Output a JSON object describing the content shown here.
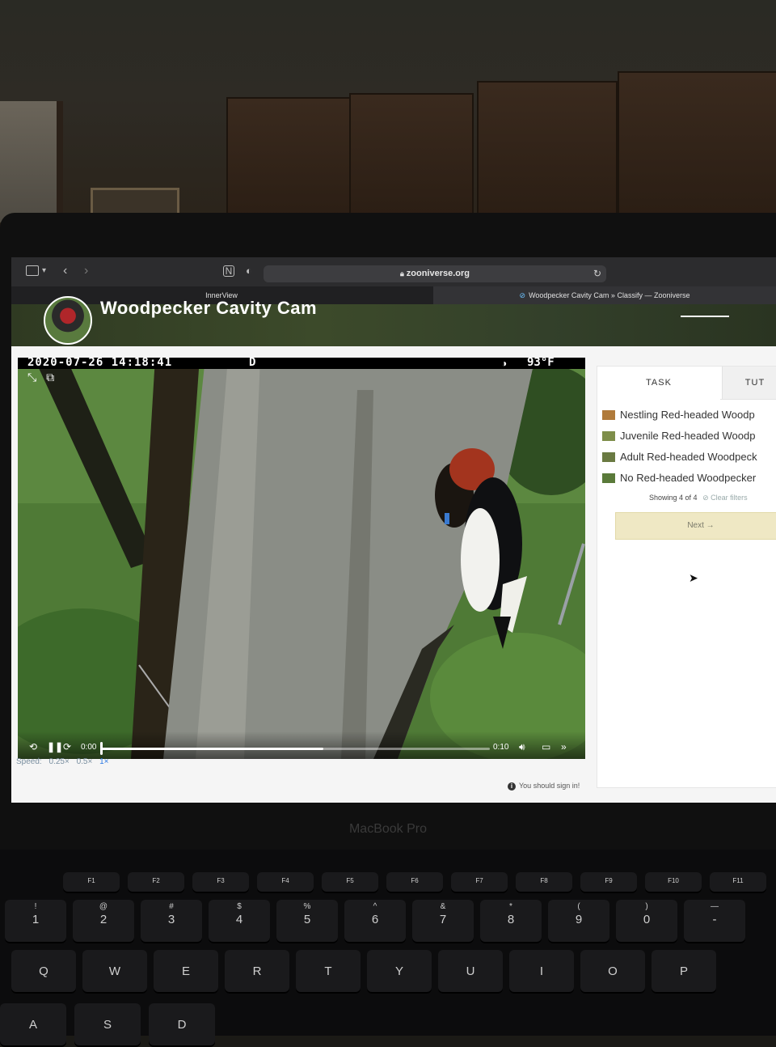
{
  "browser": {
    "url": "zooniverse.org",
    "tabs": [
      "InnerView",
      "Woodpecker Cavity Cam » Classify — Zooniverse"
    ]
  },
  "site": {
    "project_title": "Woodpecker Cavity Cam"
  },
  "video": {
    "timestamp": "2020-07-26 14:18:41",
    "mode": "D",
    "temperature": "93°F",
    "current_time": "0:00",
    "duration": "0:10",
    "progress": 0.57,
    "speed_label": "Speed:",
    "speeds": [
      "0.25×",
      "0.5×",
      "1×"
    ],
    "active_speed": "1×"
  },
  "notice": "You should sign in!",
  "task_panel": {
    "tabs": [
      "TASK",
      "TUT"
    ],
    "choices": [
      {
        "label": "Nestling Red-headed Woodp",
        "thumb_color": "#b07a3a"
      },
      {
        "label": "Juvenile Red-headed Woodp",
        "thumb_color": "#7e8e4a"
      },
      {
        "label": "Adult Red-headed Woodpeck",
        "thumb_color": "#6a7a42"
      },
      {
        "label": "No Red-headed Woodpecker",
        "thumb_color": "#5a7a3a"
      }
    ],
    "showing": "Showing 4 of 4",
    "clear_filters": "Clear filters",
    "next_button": "Next →"
  },
  "laptop": {
    "model": "MacBook Pro",
    "keys_fn": [
      "F1",
      "F2",
      "F3",
      "F4",
      "F5",
      "F6",
      "F7",
      "F8",
      "F9",
      "F10",
      "F11"
    ],
    "keys_num": [
      [
        "!",
        "1"
      ],
      [
        "@",
        "2"
      ],
      [
        "#",
        "3"
      ],
      [
        "$",
        "4"
      ],
      [
        "%",
        "5"
      ],
      [
        "^",
        "6"
      ],
      [
        "&",
        "7"
      ],
      [
        "*",
        "8"
      ],
      [
        "(",
        "9"
      ],
      [
        ")",
        "0"
      ],
      [
        "—",
        "-"
      ]
    ],
    "keys_q": [
      "Q",
      "W",
      "E",
      "R",
      "T",
      "Y",
      "U",
      "I",
      "O",
      "P"
    ],
    "keys_a": [
      "A",
      "S",
      "D"
    ]
  }
}
